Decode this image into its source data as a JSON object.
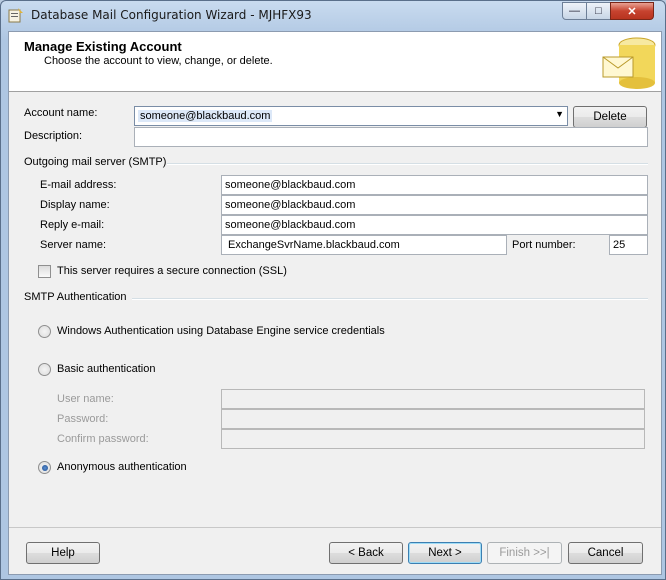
{
  "window": {
    "title": "Database Mail Configuration Wizard - MJHFX93"
  },
  "header": {
    "title": "Manage Existing Account",
    "subtitle": "Choose the account to view, change, or delete."
  },
  "account": {
    "name_label": "Account name:",
    "name_value": "someone@blackbaud.com",
    "delete_label": "Delete",
    "description_label": "Description:",
    "description_value": ""
  },
  "smtp": {
    "group_label": "Outgoing mail server (SMTP)",
    "email_label": "E-mail address:",
    "email_value": "someone@blackbaud.com",
    "display_label": "Display name:",
    "display_value": "someone@blackbaud.com",
    "reply_label": "Reply e-mail:",
    "reply_value": "someone@blackbaud.com",
    "server_label": "Server name:",
    "server_value": "ExchangeSvrName.blackbaud.com",
    "port_label": "Port number:",
    "port_value": "25",
    "ssl_label": "This server requires a secure connection (SSL)"
  },
  "auth": {
    "group_label": "SMTP Authentication",
    "windows_label": "Windows Authentication using Database Engine service credentials",
    "basic_label": "Basic authentication",
    "user_label": "User name:",
    "password_label": "Password:",
    "confirm_label": "Confirm password:",
    "anonymous_label": "Anonymous authentication",
    "selected": "anonymous"
  },
  "footer": {
    "help": "Help",
    "back": "< Back",
    "next": "Next >",
    "finish": "Finish >>|",
    "cancel": "Cancel"
  }
}
